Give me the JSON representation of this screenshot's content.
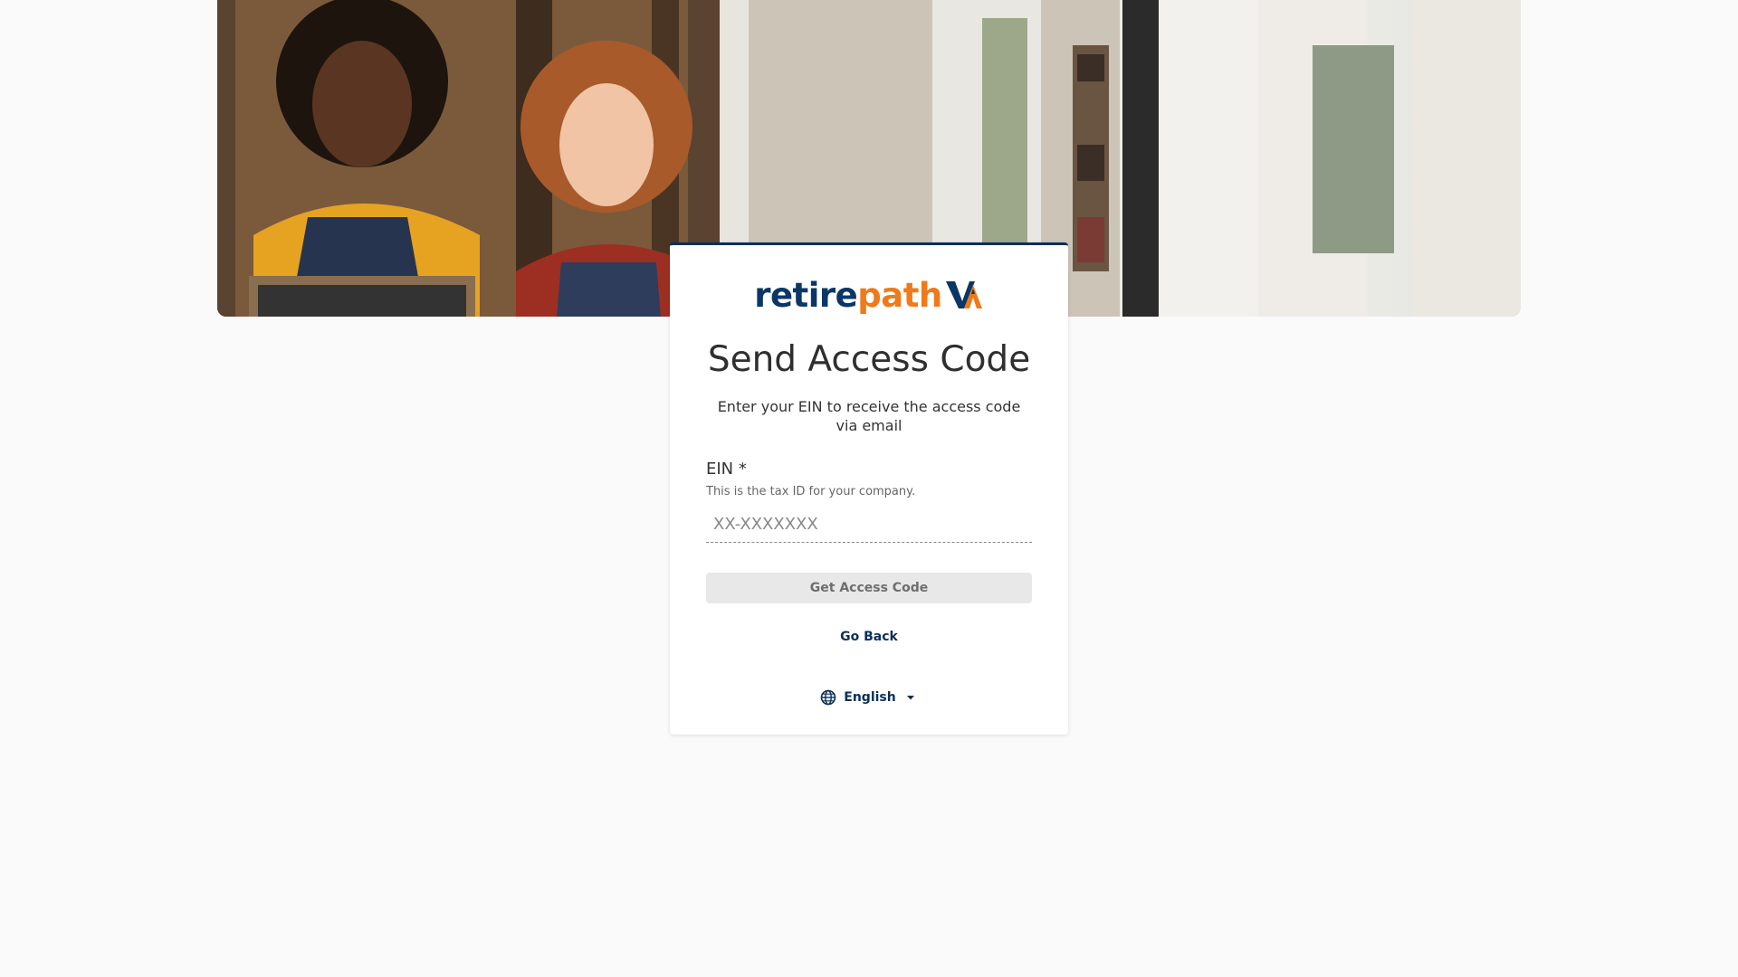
{
  "brand": {
    "name_part1": "retire",
    "name_part2": "path",
    "color_primary": "#0b3766",
    "color_accent": "#ee7a1b"
  },
  "hero": {
    "description_icon": "hero-photo"
  },
  "card": {
    "title": "Send Access Code",
    "subtitle": "Enter your EIN to receive the access code via email",
    "field": {
      "label": "EIN *",
      "hint": "This is the tax ID for your company.",
      "placeholder": "XX-XXXXXXX",
      "value": ""
    },
    "submit_label": "Get Access Code",
    "back_label": "Go Back",
    "language": {
      "selected": "English",
      "icon": "globe-icon",
      "caret_icon": "caret-down-icon"
    }
  },
  "colors": {
    "page_bg": "#fafafa",
    "card_border_top": "#0b2f57",
    "button_disabled_bg": "#e8e8e8",
    "link": "#0b2f57"
  }
}
